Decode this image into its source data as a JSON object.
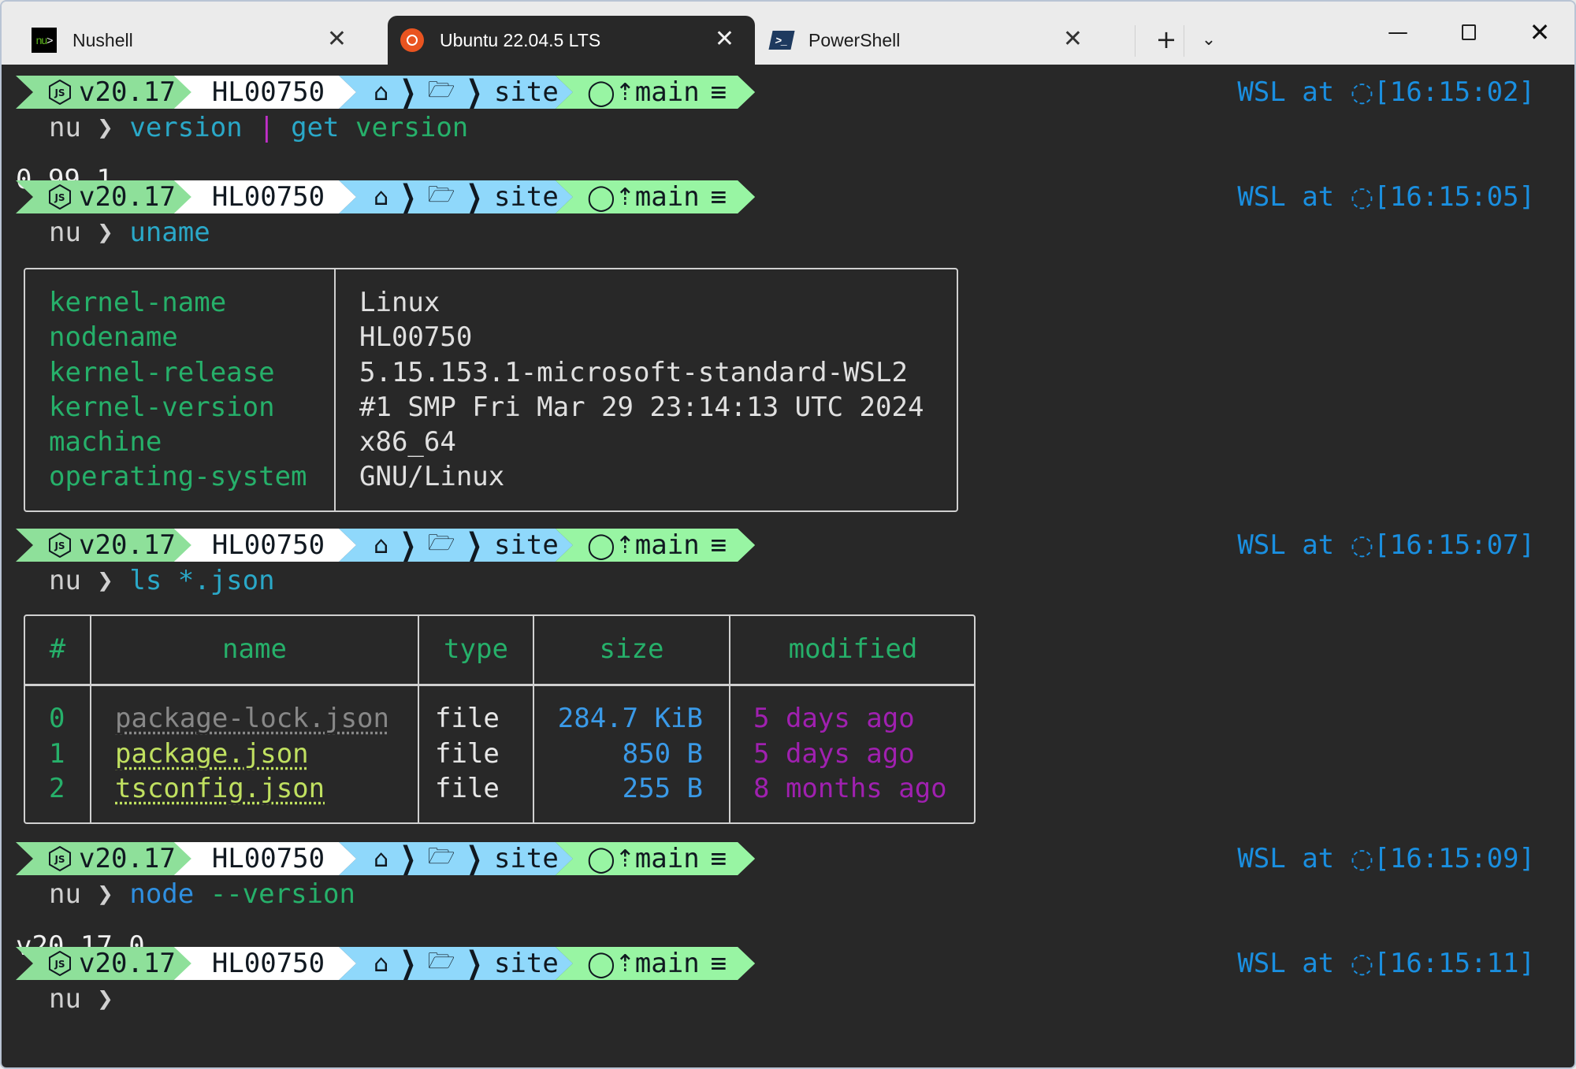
{
  "window": {
    "tabs": [
      {
        "label": "Nushell",
        "icon": "nushell-icon",
        "active": false
      },
      {
        "label": "Ubuntu 22.04.5 LTS",
        "icon": "ubuntu-icon",
        "active": true
      },
      {
        "label": "PowerShell",
        "icon": "powershell-icon",
        "active": false
      }
    ],
    "new_tab": "+",
    "dropdown": "⌄",
    "minimize": "—",
    "close": "✕",
    "tab_close": "✕"
  },
  "prompt": {
    "node_version": "v20.17",
    "host": "HL00750",
    "dir": "site",
    "branch": "main",
    "git_status": "≡",
    "right_prefix": "WSL at ",
    "nu_prompt": "nu ❯"
  },
  "blocks": [
    {
      "time": "[16:15:02]",
      "cmd": [
        {
          "t": "version",
          "c": "cyan"
        },
        {
          "t": " | ",
          "c": "magenta"
        },
        {
          "t": "get",
          "c": "cyan"
        },
        {
          "t": " version",
          "c": "green"
        }
      ],
      "output": "0.99.1"
    },
    {
      "time": "[16:15:05]",
      "cmd": [
        {
          "t": "uname",
          "c": "cyan"
        }
      ]
    },
    {
      "time": "[16:15:07]",
      "cmd": [
        {
          "t": "ls *.json",
          "c": "cyan"
        }
      ]
    },
    {
      "time": "[16:15:09]",
      "cmd": [
        {
          "t": "node",
          "c": "blue"
        },
        {
          "t": " --version",
          "c": "green"
        }
      ],
      "output": "v20.17.0"
    },
    {
      "time": "[16:15:11]",
      "cmd": []
    }
  ],
  "uname": [
    {
      "key": "kernel-name",
      "value": "Linux"
    },
    {
      "key": "nodename",
      "value": "HL00750"
    },
    {
      "key": "kernel-release",
      "value": "5.15.153.1-microsoft-standard-WSL2"
    },
    {
      "key": "kernel-version",
      "value": "#1 SMP Fri Mar 29 23:14:13 UTC 2024"
    },
    {
      "key": "machine",
      "value": "x86_64"
    },
    {
      "key": "operating-system",
      "value": "GNU/Linux"
    }
  ],
  "ls": {
    "headers": [
      "#",
      "name",
      "type",
      "size",
      "modified"
    ],
    "rows": [
      {
        "idx": "0",
        "name": "package-lock.json",
        "type": "file",
        "size": "284.7 KiB",
        "modified": "5 days ago"
      },
      {
        "idx": "1",
        "name": "package.json",
        "type": "file",
        "size": "850 B",
        "modified": "5 days ago"
      },
      {
        "idx": "2",
        "name": "tsconfig.json",
        "type": "file",
        "size": "255 B",
        "modified": "8 months ago"
      }
    ]
  },
  "colors": {
    "terminal_bg": "#282828",
    "node_segment": "#8ee09a",
    "host_segment": "#ffffff",
    "path_segment": "#8fd8fb",
    "git_segment": "#98f5a3",
    "right_status": "#1a8fe0",
    "ubuntu_orange": "#e95420"
  }
}
